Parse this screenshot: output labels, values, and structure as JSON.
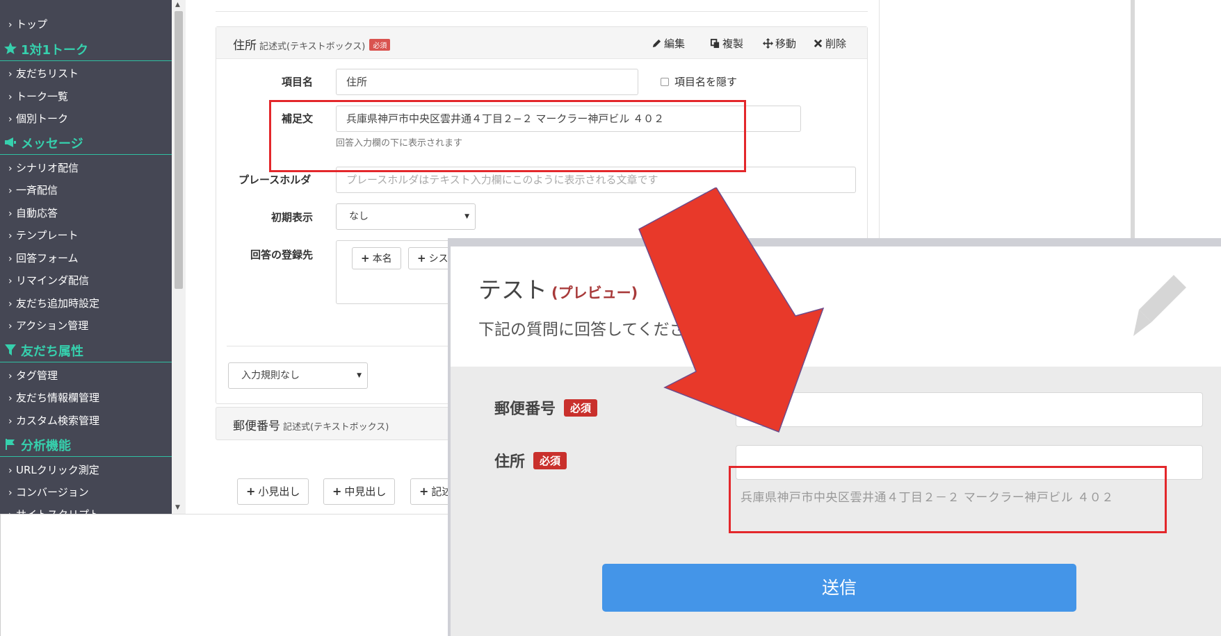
{
  "sidebar": {
    "items": [
      {
        "label": "トップ"
      },
      {
        "label": "友だちリスト"
      },
      {
        "label": "トーク一覧"
      },
      {
        "label": "個別トーク"
      },
      {
        "label": "シナリオ配信"
      },
      {
        "label": "一斉配信"
      },
      {
        "label": "自動応答"
      },
      {
        "label": "テンプレート"
      },
      {
        "label": "回答フォーム"
      },
      {
        "label": "リマインダ配信"
      },
      {
        "label": "友だち追加時設定"
      },
      {
        "label": "アクション管理"
      },
      {
        "label": "タグ管理"
      },
      {
        "label": "友だち情報欄管理"
      },
      {
        "label": "カスタム検索管理"
      },
      {
        "label": "URLクリック測定"
      },
      {
        "label": "コンバージョン"
      },
      {
        "label": "サイトスクリプト"
      }
    ],
    "sections": [
      {
        "label": "1対1トーク",
        "icon": "star-icon"
      },
      {
        "label": "メッセージ",
        "icon": "megaphone-icon"
      },
      {
        "label": "友だち属性",
        "icon": "filter-icon"
      },
      {
        "label": "分析機能",
        "icon": "flag-icon"
      }
    ],
    "accent_color": "#36d0ad",
    "bg_color": "#454754"
  },
  "editor": {
    "card_title": "住所",
    "card_type": "記述式(テキストボックス)",
    "required_badge": "必須",
    "actions": {
      "edit": "編集",
      "copy": "複製",
      "move": "移動",
      "delete": "削除"
    },
    "labels": {
      "item_name": "項目名",
      "supplement": "補足文",
      "placeholder": "プレースホルダ",
      "initial": "初期表示",
      "register": "回答の登録先"
    },
    "item_name_value": "住所",
    "hide_name_label": "項目名を隠す",
    "supplement_value": "兵庫県神戸市中央区雲井通４丁目２−２ マークラー神戸ビル ４０２",
    "supplement_help": "回答入力欄の下に表示されます",
    "placeholder_hint": "プレースホルダはテキスト入力欄にこのように表示される文章です",
    "initial_value": "なし",
    "register_buttons": [
      "本名",
      "シス"
    ],
    "input_rule": "入力規則なし",
    "card2_title": "郵便番号",
    "card2_type": "記述式(テキストボックス)",
    "add_buttons": [
      "小見出し",
      "中見出し",
      "記述"
    ]
  },
  "preview": {
    "title": "テスト",
    "title_sub": "(プレビュー)",
    "description": "下記の質問に回答してくださ",
    "fields": [
      {
        "label": "郵便番号",
        "badge": "必須"
      },
      {
        "label": "住所",
        "badge": "必須",
        "help": "兵庫県神戸市中央区雲井通４丁目２－２ マークラー神戸ビル ４０２"
      }
    ],
    "submit": "送信",
    "submit_color": "#4495e8",
    "required_color": "#c9302c"
  },
  "highlight_color": "#e3272b",
  "arrow_color": "#e8392a"
}
